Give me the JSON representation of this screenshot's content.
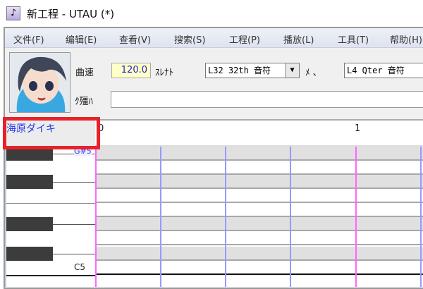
{
  "window": {
    "icon": "music-note-icon",
    "title": "新工程 - UTAU (*)"
  },
  "menu": [
    "文件(F)",
    "编辑(E)",
    "查看(V)",
    "搜索(S)",
    "工程(P)",
    "播放(L)",
    "工具(T)",
    "帮助(H)"
  ],
  "toolbar": {
    "tempo_label": "曲速",
    "tempo_value": "120.0",
    "quantize_label": "ｽﾚﾅﾄ",
    "quantize_value": "L32 32th 音符",
    "length_label": "ﾒ 、",
    "length_value": "L4  Qter 音符",
    "lyric_label": "ｸ殭ﾊ",
    "lyric_value": ""
  },
  "track": {
    "singer_name": "海原ダイキ",
    "measures": [
      "0",
      "1"
    ]
  },
  "piano": {
    "top_note": "G#5",
    "bottom_note": "C5"
  },
  "colors": {
    "highlight": "#e8222a",
    "measure_line": "#ff66ff",
    "beat_line": "#9999ff",
    "singer_text": "#2233ee"
  }
}
